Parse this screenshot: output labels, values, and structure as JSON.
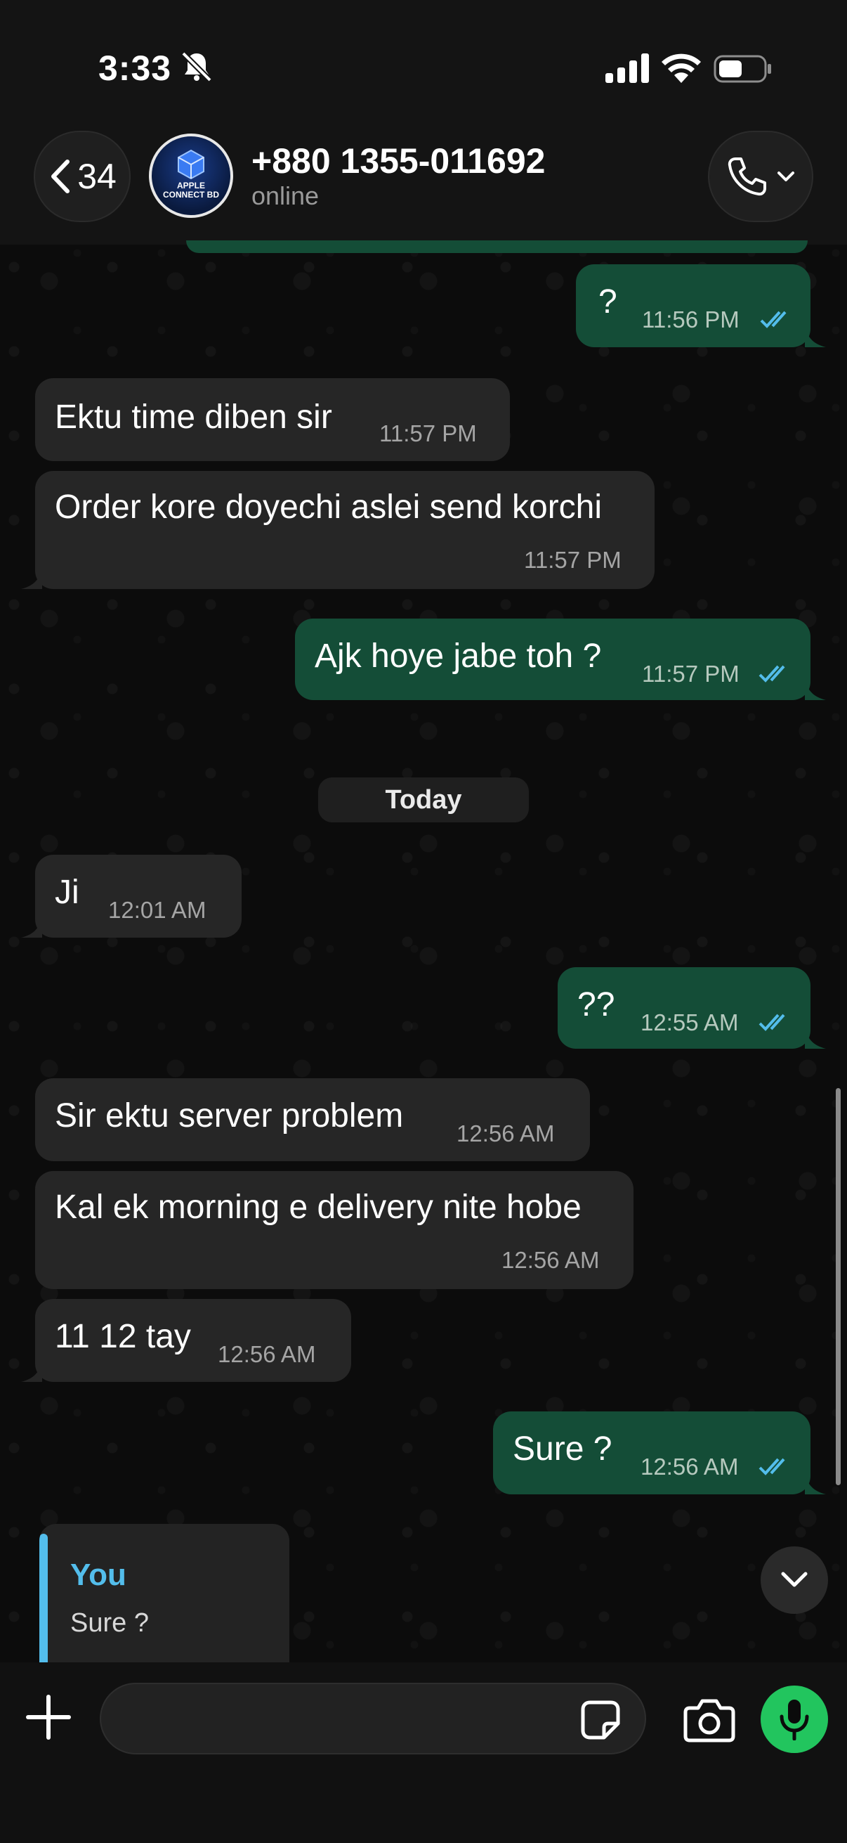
{
  "status_bar": {
    "time": "3:33"
  },
  "header": {
    "back_count": "34",
    "contact_name": "+880 1355-011692",
    "contact_status": "online",
    "avatar_text_line1": "APPLE",
    "avatar_text_line2": "CONNECT BD"
  },
  "messages": [
    {
      "dir": "out",
      "text": "?",
      "time": "11:56 PM",
      "read": true
    },
    {
      "dir": "in",
      "text": "Ektu time diben sir",
      "time": "11:57 PM"
    },
    {
      "dir": "in",
      "text": "Order kore doyechi aslei send korchi",
      "time": "11:57 PM"
    },
    {
      "dir": "out",
      "text": "Ajk hoye jabe toh ?",
      "time": "11:57 PM",
      "read": true
    },
    {
      "dir": "in",
      "text": "Ji",
      "time": "12:01 AM"
    },
    {
      "dir": "out",
      "text": "??",
      "time": "12:55 AM",
      "read": true
    },
    {
      "dir": "in",
      "text": "Sir ektu server problem",
      "time": "12:56 AM"
    },
    {
      "dir": "in",
      "text": "Kal ek morning e delivery nite hobe",
      "time": "12:56 AM"
    },
    {
      "dir": "in",
      "text": "11 12 tay",
      "time": "12:56 AM"
    },
    {
      "dir": "out",
      "text": "Sure ?",
      "time": "12:56 AM",
      "read": true
    }
  ],
  "date_separator": "Today",
  "reply_preview": {
    "author": "You",
    "text": "Sure ?"
  },
  "input": {
    "value": "",
    "placeholder": ""
  },
  "colors": {
    "outgoing": "#144d37",
    "incoming": "#262626",
    "accent": "#22c55e",
    "read_tick": "#53bdeb"
  },
  "icons": [
    "mute-icon",
    "signal-icon",
    "wifi-icon",
    "battery-icon",
    "chevron-left-icon",
    "phone-icon",
    "chevron-down-icon",
    "plus-icon",
    "sticker-icon",
    "camera-icon",
    "microphone-icon",
    "double-check-icon"
  ]
}
